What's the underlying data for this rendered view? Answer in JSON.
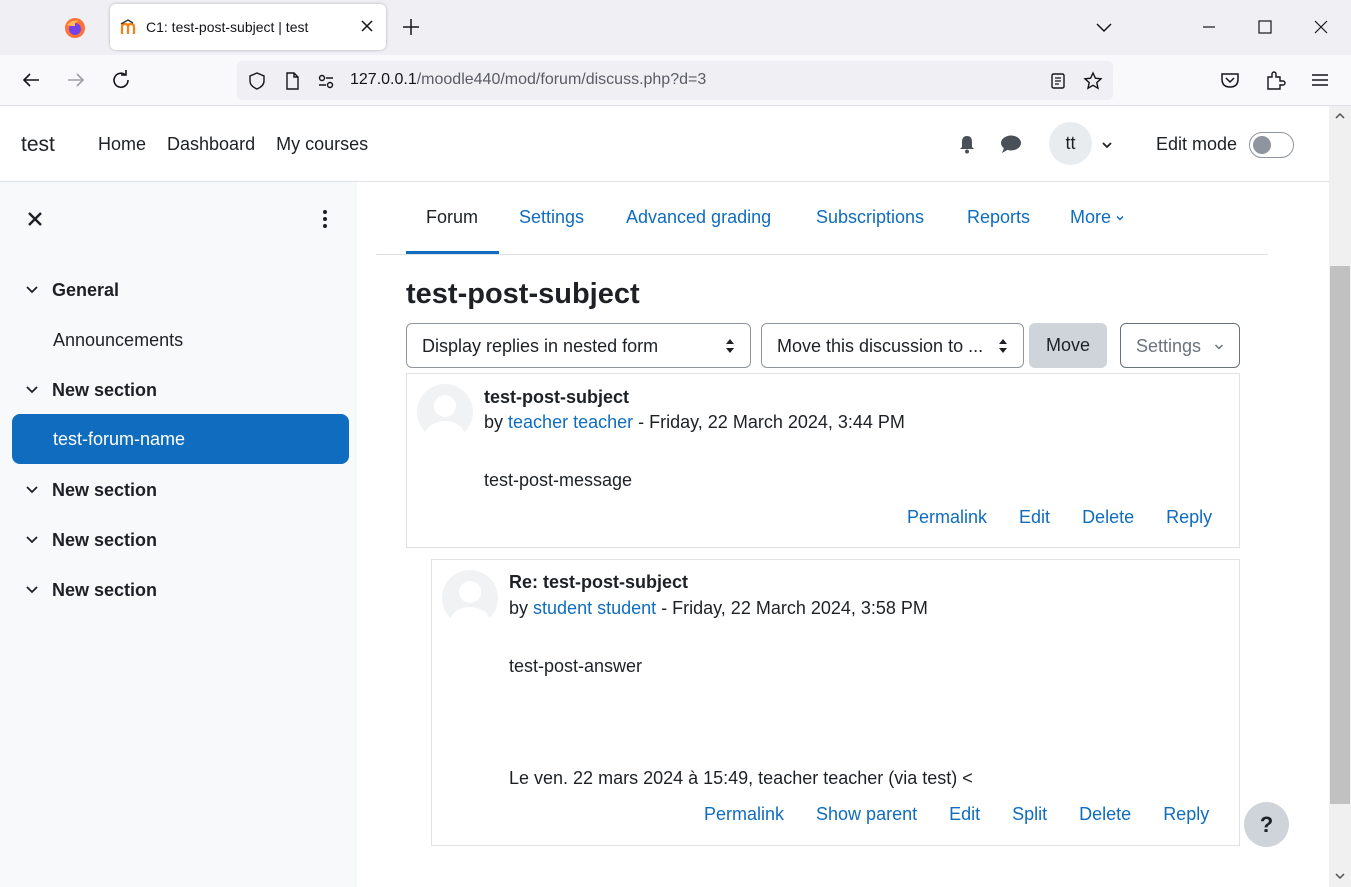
{
  "browser": {
    "tab_title": "C1: test-post-subject | test",
    "url_host": "127.0.0.1",
    "url_path": "/moodle440/mod/forum/discuss.php?d=3"
  },
  "header": {
    "site_name": "test",
    "nav": [
      "Home",
      "Dashboard",
      "My courses"
    ],
    "avatar_initials": "tt",
    "edit_mode_label": "Edit mode"
  },
  "drawer": {
    "sections": [
      {
        "label": "General"
      },
      {
        "label": "New section"
      },
      {
        "label": "New section"
      },
      {
        "label": "New section"
      },
      {
        "label": "New section"
      }
    ],
    "items": [
      {
        "label": "Announcements"
      },
      {
        "label": "test-forum-name",
        "active": true
      }
    ]
  },
  "secondary_nav": {
    "items": [
      "Forum",
      "Settings",
      "Advanced grading",
      "Subscriptions",
      "Reports",
      "More"
    ],
    "active": "Forum"
  },
  "discussion": {
    "title": "test-post-subject",
    "display_mode": "Display replies in nested form",
    "move_placeholder": "Move this discussion to ...",
    "move_button": "Move",
    "settings_button": "Settings"
  },
  "posts": [
    {
      "subject": "test-post-subject",
      "by": "by",
      "author": "teacher teacher",
      "date": "- Friday, 22 March 2024, 3:44 PM",
      "message": "test-post-message",
      "actions": [
        "Permalink",
        "Edit",
        "Delete",
        "Reply"
      ]
    },
    {
      "subject": "Re: test-post-subject",
      "by": "by",
      "author": "student student",
      "date": "- Friday, 22 March 2024, 3:58 PM",
      "message": "test-post-answer",
      "quote": "Le ven. 22 mars 2024 à 15:49, teacher teacher (via test) <",
      "actions": [
        "Permalink",
        "Show parent",
        "Edit",
        "Split",
        "Delete",
        "Reply"
      ]
    }
  ],
  "help_button": "?"
}
